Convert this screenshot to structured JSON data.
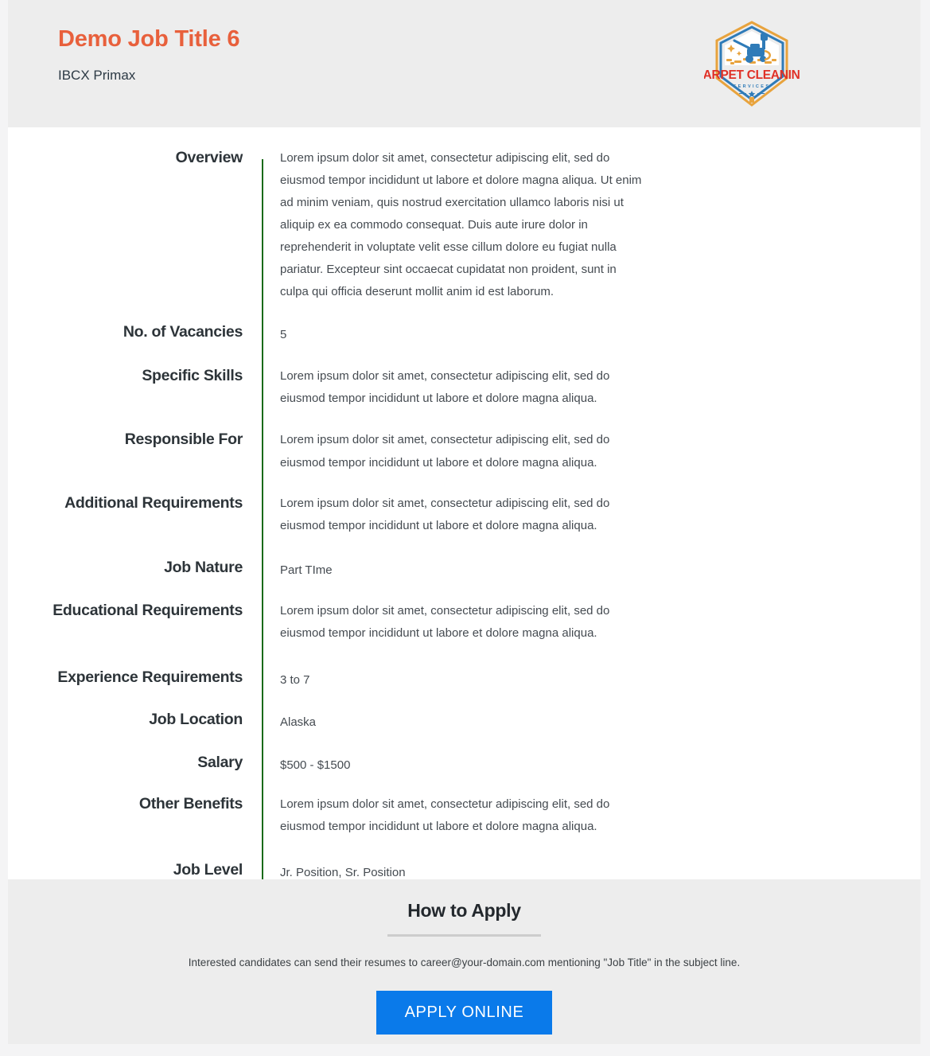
{
  "header": {
    "job_title": "Demo Job Title 6",
    "company_name": "IBCX Primax",
    "logo": {
      "name": "carpet-cleaning-services-logo",
      "primary_text": "CARPET CLEANING",
      "secondary_text": "SERVICES",
      "badge_color": "#2f7bb8",
      "text_color": "#e03127",
      "accent_color": "#e8a33d"
    }
  },
  "colors": {
    "title_accent": "#e8603c",
    "divider_green": "#1a6b1a",
    "button_blue": "#0a7aea",
    "panel_gray": "#ededed",
    "page_bg": "#f4f4f5"
  },
  "details": {
    "labels": {
      "overview": "Overview",
      "vacancies": "No. of Vacancies",
      "skills": "Specific Skills",
      "responsible": "Responsible For",
      "additional": "Additional Requirements",
      "nature": "Job Nature",
      "education": "Educational Requirements",
      "experience": "Experience Requirements",
      "location": "Job Location",
      "salary": "Salary",
      "benefits": "Other Benefits",
      "level": "Job Level"
    },
    "values": {
      "overview": "Lorem ipsum dolor sit amet, consectetur adipiscing elit, sed do eiusmod tempor incididunt ut labore et dolore magna aliqua. Ut enim ad minim veniam, quis nostrud exercitation ullamco laboris nisi ut aliquip ex ea commodo consequat. Duis aute irure dolor in reprehenderit in voluptate velit esse cillum dolore eu fugiat nulla pariatur. Excepteur sint occaecat cupidatat non proident, sunt in culpa qui officia deserunt mollit anim id est laborum.",
      "vacancies": "5",
      "skills": "Lorem ipsum dolor sit amet, consectetur adipiscing elit, sed do eiusmod tempor incididunt ut labore et dolore magna aliqua.",
      "responsible": "Lorem ipsum dolor sit amet, consectetur adipiscing elit, sed do eiusmod tempor incididunt ut labore et dolore magna aliqua.",
      "additional": "Lorem ipsum dolor sit amet, consectetur adipiscing elit, sed do eiusmod tempor incididunt ut labore et dolore magna aliqua.",
      "nature": "Part TIme",
      "education": "Lorem ipsum dolor sit amet, consectetur adipiscing elit, sed do eiusmod tempor incididunt ut labore et dolore magna aliqua.",
      "experience": "3 to 7",
      "location": "Alaska",
      "salary": "$500 - $1500",
      "benefits": "Lorem ipsum dolor sit amet, consectetur adipiscing elit, sed do eiusmod tempor incididunt ut labore et dolore magna aliqua.",
      "level": "Jr. Position, Sr. Position"
    }
  },
  "apply": {
    "heading": "How to Apply",
    "instructions": "Interested candidates can send their resumes to career@your-domain.com mentioning \"Job Title\" in the subject line.",
    "button_label": "APPLY ONLINE"
  }
}
